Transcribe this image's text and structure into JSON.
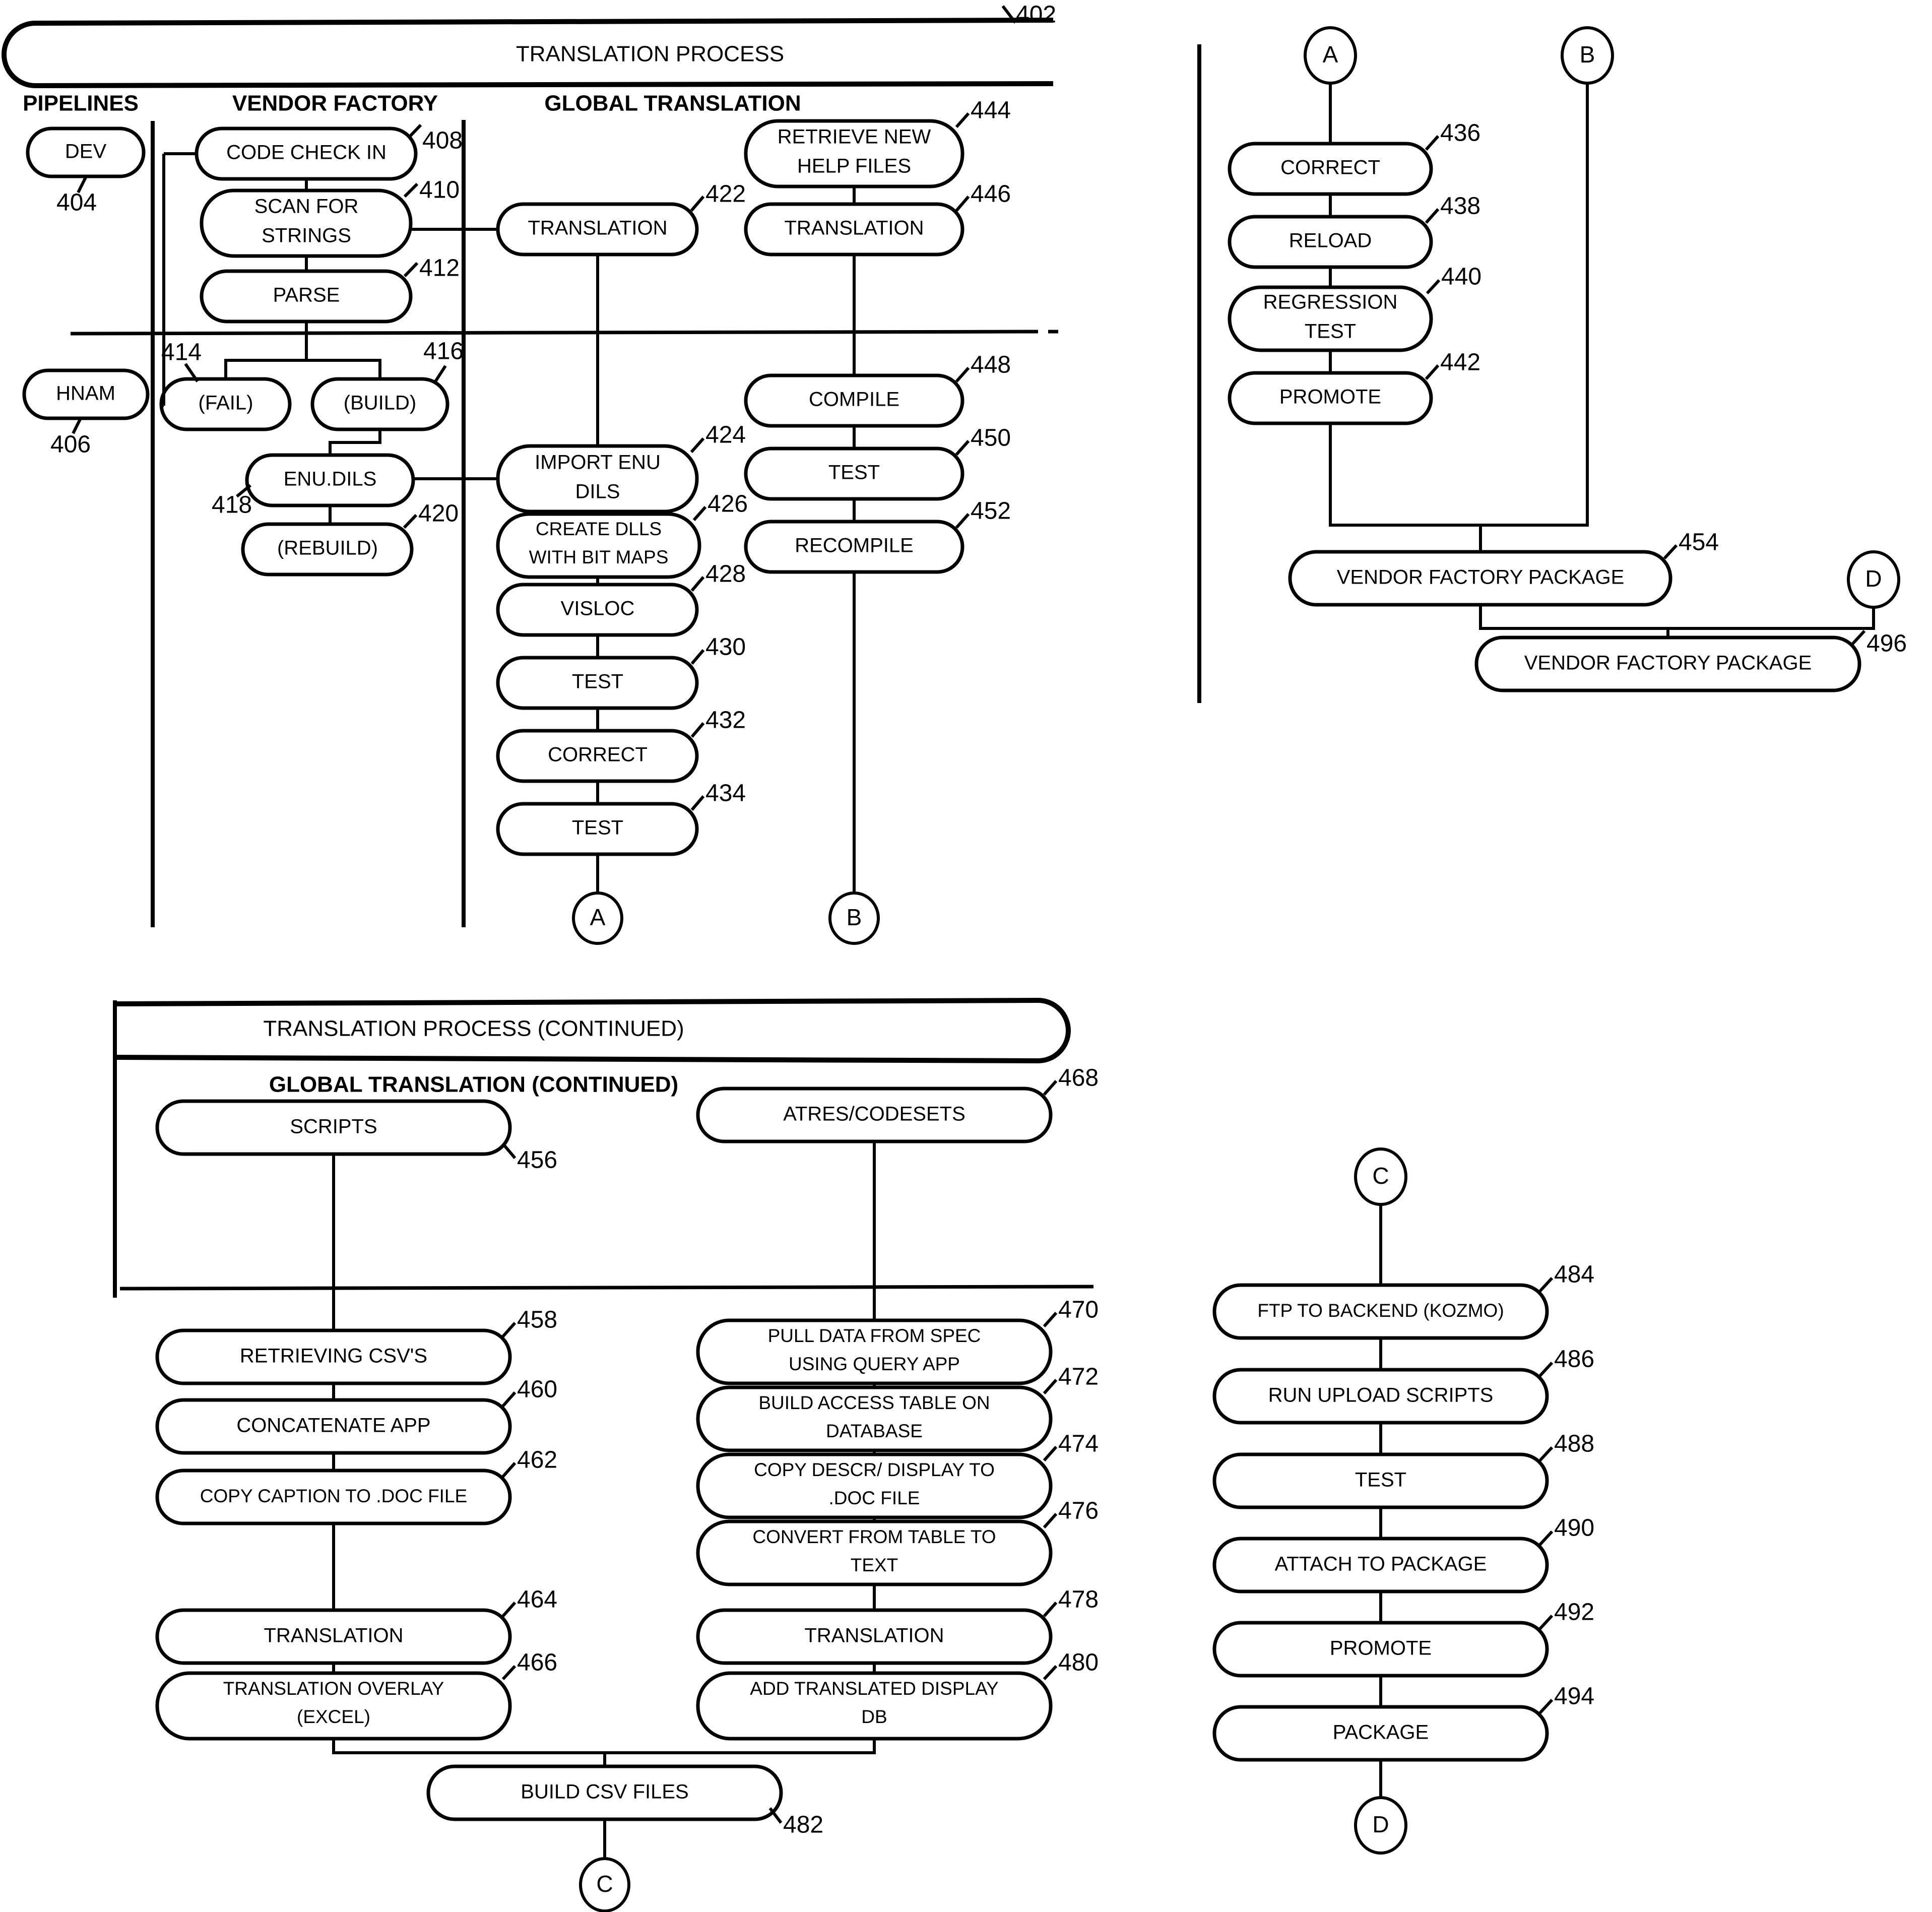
{
  "figure": {
    "title": "TRANSLATION PROCESS",
    "title_ref": "402",
    "continued_title": "TRANSLATION PROCESS (CONTINUED)",
    "continued_subtitle": "GLOBAL TRANSLATION (CONTINUED)"
  },
  "headings": {
    "pipelines": "PIPELINES",
    "vendor_factory": "VENDOR FACTORY",
    "global_translation": "GLOBAL TRANSLATION"
  },
  "nodes": {
    "dev": {
      "label": "DEV",
      "ref": "404"
    },
    "hnam": {
      "label": "HNAM",
      "ref": "406"
    },
    "code_check_in": {
      "label": "CODE CHECK IN",
      "ref": "408"
    },
    "scan_for_strings": {
      "label_1": "SCAN FOR",
      "label_2": "STRINGS",
      "ref": "410"
    },
    "parse": {
      "label": "PARSE",
      "ref": "412"
    },
    "fail": {
      "label": "(FAIL)",
      "ref": "414"
    },
    "build": {
      "label": "(BUILD)",
      "ref": "416"
    },
    "enu_dils": {
      "label": "ENU.DILS",
      "ref": "418"
    },
    "rebuild": {
      "label": "(REBUILD)",
      "ref": "420"
    },
    "translation_422": {
      "label": "TRANSLATION",
      "ref": "422"
    },
    "import_enu_dils": {
      "label_1": "IMPORT ENU",
      "label_2": "DILS",
      "ref": "424"
    },
    "create_dlls": {
      "label_1": "CREATE DLLS",
      "label_2": "WITH BIT MAPS",
      "ref": "426"
    },
    "visloc": {
      "label": "VISLOC",
      "ref": "428"
    },
    "test_430": {
      "label": "TEST",
      "ref": "430"
    },
    "correct_432": {
      "label": "CORRECT",
      "ref": "432"
    },
    "test_434": {
      "label": "TEST",
      "ref": "434"
    },
    "retrieve_help": {
      "label_1": "RETRIEVE NEW",
      "label_2": "HELP FILES",
      "ref": "444"
    },
    "translation_446": {
      "label": "TRANSLATION",
      "ref": "446"
    },
    "compile": {
      "label": "COMPILE",
      "ref": "448"
    },
    "test_450": {
      "label": "TEST",
      "ref": "450"
    },
    "recompile": {
      "label": "RECOMPILE",
      "ref": "452"
    },
    "correct_436": {
      "label": "CORRECT",
      "ref": "436"
    },
    "reload": {
      "label": "RELOAD",
      "ref": "438"
    },
    "regression_test": {
      "label_1": "REGRESSION",
      "label_2": "TEST",
      "ref": "440"
    },
    "promote_442": {
      "label": "PROMOTE",
      "ref": "442"
    },
    "vendor_factory_package_454": {
      "label": "VENDOR FACTORY PACKAGE",
      "ref": "454"
    },
    "vendor_factory_package_496": {
      "label": "VENDOR FACTORY PACKAGE",
      "ref": "496"
    },
    "scripts": {
      "label": "SCRIPTS",
      "ref": "456"
    },
    "retrieving_csvs": {
      "label": "RETRIEVING CSV'S",
      "ref": "458"
    },
    "concatenate_app": {
      "label": "CONCATENATE APP",
      "ref": "460"
    },
    "copy_caption": {
      "label": "COPY CAPTION TO .DOC FILE",
      "ref": "462"
    },
    "translation_464": {
      "label": "TRANSLATION",
      "ref": "464"
    },
    "translation_overlay": {
      "label_1": "TRANSLATION OVERLAY",
      "label_2": "(EXCEL)",
      "ref": "466"
    },
    "atres_codesets": {
      "label": "ATRES/CODESETS",
      "ref": "468"
    },
    "pull_data": {
      "label_1": "PULL DATA FROM SPEC",
      "label_2": "USING QUERY APP",
      "ref": "470"
    },
    "build_access_table": {
      "label_1": "BUILD ACCESS TABLE ON",
      "label_2": "DATABASE",
      "ref": "472"
    },
    "copy_descr": {
      "label_1": "COPY DESCR/ DISPLAY TO",
      "label_2": ".DOC FILE",
      "ref": "474"
    },
    "convert_table": {
      "label_1": "CONVERT FROM TABLE TO",
      "label_2": "TEXT",
      "ref": "476"
    },
    "translation_478": {
      "label": "TRANSLATION",
      "ref": "478"
    },
    "add_translated_display": {
      "label_1": "ADD TRANSLATED DISPLAY",
      "label_2": "DB",
      "ref": "480"
    },
    "build_csv_files": {
      "label": "BUILD CSV FILES",
      "ref": "482"
    },
    "ftp_backend": {
      "label": "FTP TO BACKEND (KOZMO)",
      "ref": "484"
    },
    "run_upload_scripts": {
      "label": "RUN UPLOAD SCRIPTS",
      "ref": "486"
    },
    "test_488": {
      "label": "TEST",
      "ref": "488"
    },
    "attach_to_package": {
      "label": "ATTACH TO PACKAGE",
      "ref": "490"
    },
    "promote_492": {
      "label": "PROMOTE",
      "ref": "492"
    },
    "package_494": {
      "label": "PACKAGE",
      "ref": "494"
    }
  },
  "connectors": {
    "a_out": "A",
    "b_out": "B",
    "a_in": "A",
    "b_in": "B",
    "c_out": "C",
    "c_in": "C",
    "d_out": "D",
    "d_in": "D"
  },
  "colors": {
    "stroke": "#000000",
    "fill": "#ffffff"
  }
}
